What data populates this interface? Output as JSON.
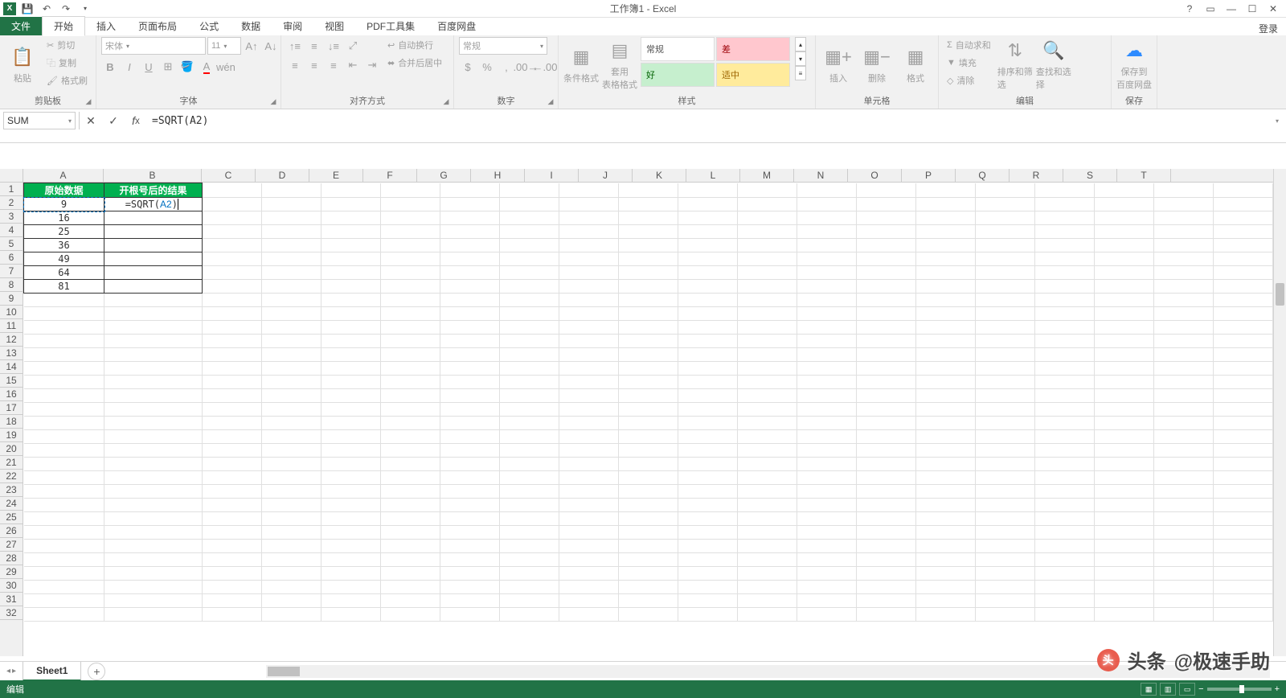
{
  "title": "工作簿1 - Excel",
  "login": "登录",
  "tabs": {
    "file": "文件",
    "list": [
      "开始",
      "插入",
      "页面布局",
      "公式",
      "数据",
      "审阅",
      "视图",
      "PDF工具集",
      "百度网盘"
    ],
    "active": "开始"
  },
  "ribbon": {
    "clipboard": {
      "paste": "粘贴",
      "cut": "剪切",
      "copy": "复制",
      "format_painter": "格式刷",
      "label": "剪贴板"
    },
    "font": {
      "name": "宋体",
      "size": "11",
      "label": "字体"
    },
    "alignment": {
      "wrap": "自动换行",
      "merge": "合并后居中",
      "label": "对齐方式"
    },
    "number": {
      "format": "常规",
      "label": "数字"
    },
    "styles": {
      "cond": "条件格式",
      "table": "套用\n表格格式",
      "normal": "常规",
      "bad": "差",
      "good": "好",
      "neutral": "适中",
      "label": "样式"
    },
    "cells": {
      "insert": "插入",
      "delete": "删除",
      "format": "格式",
      "label": "单元格"
    },
    "editing": {
      "sum": "自动求和",
      "fill": "填充",
      "clear": "清除",
      "sort": "排序和筛选",
      "find": "查找和选择",
      "label": "编辑"
    },
    "save": {
      "btn": "保存到\n百度网盘",
      "label": "保存"
    }
  },
  "nameBox": "SUM",
  "formula": "=SQRT(A2)",
  "columns": [
    "A",
    "B",
    "C",
    "D",
    "E",
    "F",
    "G",
    "H",
    "I",
    "J",
    "K",
    "L",
    "M",
    "N",
    "O",
    "P",
    "Q",
    "R",
    "S",
    "T"
  ],
  "headerA": "原始数据",
  "headerB": "开根号后的结果",
  "colA": [
    "9",
    "16",
    "25",
    "36",
    "49",
    "64",
    "81"
  ],
  "editCell": {
    "prefix": "=SQRT(",
    "ref": "A2",
    "suffix": ")"
  },
  "sheet": "Sheet1",
  "status": "编辑",
  "watermark": {
    "prefix": "头条",
    "user": "@极速手助"
  }
}
